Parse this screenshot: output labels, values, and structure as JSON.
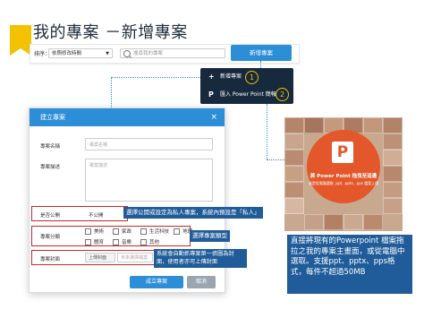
{
  "header": {
    "title": "我的專案 －新增專案"
  },
  "toolbar": {
    "sort_label": "排序：",
    "sort_value": "依照修改時間",
    "search_placeholder": "搜尋我的專案",
    "new_project_label": "新增專案"
  },
  "dropdown": {
    "items": [
      {
        "icon": "plus-icon",
        "glyph": "+",
        "label": "新增專案",
        "badge": "1"
      },
      {
        "icon": "powerpoint-icon",
        "glyph": "P",
        "label": "匯入 Power Point 簡報",
        "badge": "2"
      }
    ]
  },
  "modal": {
    "title": "建立專案",
    "fields": {
      "name_label": "專案名稱",
      "name_placeholder": "專案名稱",
      "desc_label": "專案描述",
      "desc_placeholder": "專案描述",
      "public_label": "是否公開",
      "public_value": "不公開",
      "category_label": "專案分類",
      "categories": [
        "美術",
        "家政",
        "生活科技",
        "地理",
        "體育",
        "音樂",
        "其他"
      ],
      "cover_label": "專案封面",
      "upload_label": "上傳封面",
      "cover_hint": "未來選擇檔案"
    },
    "create_label": "成立專案",
    "cancel_label": "取消"
  },
  "callouts": {
    "public": "選擇公開或設定為私人專案，系統內預設是「私人」",
    "category": "選擇專案類型",
    "cover": "系統會自動抓專案第一張圖為封面，使用者亦可上傳封面"
  },
  "ppt_card": {
    "line1": "將 Power Point 拖曳至這邊",
    "line2": "或是從電腦選取 .ppt, .pptx, .pps 檔案上傳"
  },
  "description": "直接將現有的Powerpoint 檔案拖拉之我的專案主畫面，或從電腦中選取。支援ppt、pptx、pps格式，每件不超過50MB",
  "colors": {
    "accent": "#2d8ed8",
    "dark": "#16293d",
    "callout": "#1f5c99",
    "highlight": "#f2c200",
    "ppt": "#e3572a",
    "red": "#c62828"
  }
}
